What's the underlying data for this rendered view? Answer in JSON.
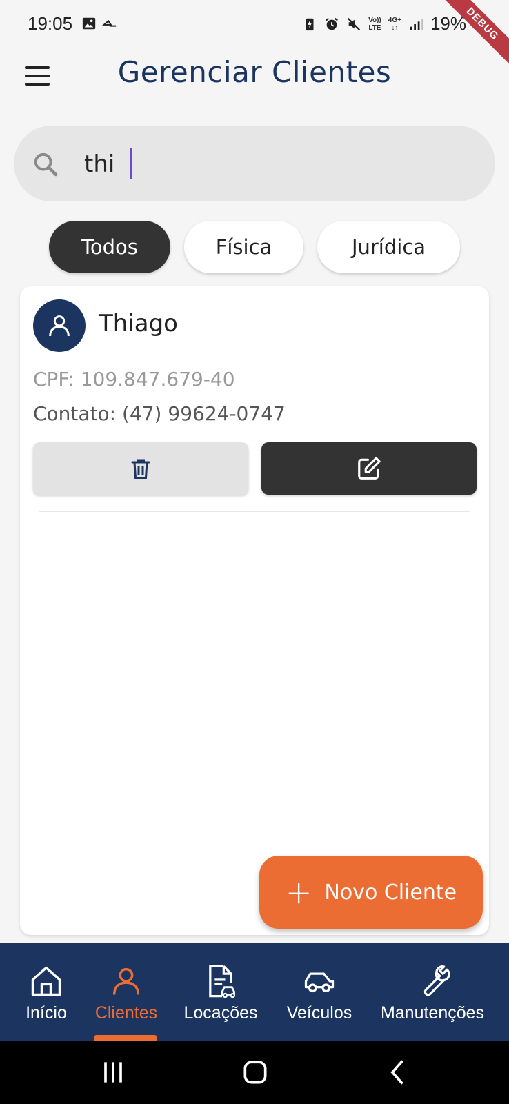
{
  "status_bar": {
    "time": "19:05",
    "battery": "19%",
    "network_top": "4G+",
    "volte_top": "Vo))",
    "volte_bottom": "LTE",
    "debug_label": "DEBUG",
    "icons": [
      "image-icon",
      "cast-icon",
      "battery-saver-icon",
      "alarm-icon",
      "mute-icon",
      "signal-icon"
    ]
  },
  "header": {
    "title": "Gerenciar Clientes",
    "menu_icon": "hamburger-menu-icon"
  },
  "search": {
    "value": "thi",
    "placeholder": "",
    "icon": "search-icon"
  },
  "filters": {
    "active": "Todos",
    "options": [
      "Todos",
      "Física",
      "Jurídica"
    ]
  },
  "clients": [
    {
      "name": "Thiago",
      "cpf": "CPF: 109.847.679-40",
      "contact": "Contato: (47) 99624-0747",
      "avatar_icon": "person-icon",
      "delete_icon": "trash-icon",
      "edit_icon": "edit-icon"
    }
  ],
  "fab": {
    "label": "Novo Cliente",
    "icon": "plus-icon"
  },
  "bottom_nav": {
    "active": "Clientes",
    "items": [
      {
        "label": "Início",
        "icon": "home-icon"
      },
      {
        "label": "Clientes",
        "icon": "person-icon"
      },
      {
        "label": "Locações",
        "icon": "document-car-icon"
      },
      {
        "label": "Veículos",
        "icon": "car-icon"
      },
      {
        "label": "Manutenções",
        "icon": "wrench-icon"
      }
    ]
  },
  "colors": {
    "primary": "#1b3560",
    "accent": "#ec6d33",
    "dark": "#333333",
    "background": "#f5f5f5"
  }
}
